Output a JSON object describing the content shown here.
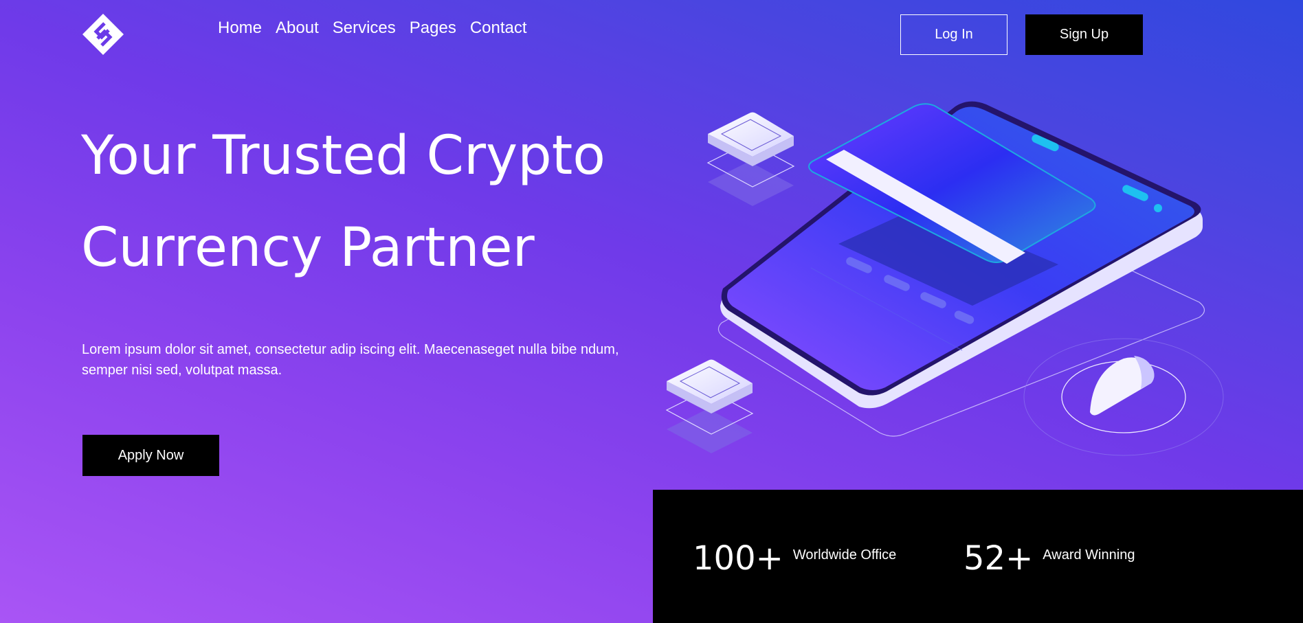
{
  "header": {
    "logo_icon": "diamond-s-logo-icon",
    "nav": [
      {
        "label": "Home"
      },
      {
        "label": "About"
      },
      {
        "label": "Services"
      },
      {
        "label": "Pages"
      },
      {
        "label": "Contact"
      }
    ],
    "login_label": "Log In",
    "signup_label": "Sign Up"
  },
  "hero": {
    "title_line1": "Your Trusted Crypto",
    "title_line2": "Currency Partner",
    "description": "Lorem ipsum dolor sit amet, consectetur adip iscing elit. Maecenaseget nulla bibe ndum, semper nisi sed, volutpat massa.",
    "apply_label": "Apply Now",
    "illustration_icon": "phone-credit-card-illustration"
  },
  "stats": [
    {
      "number": "100+",
      "label": "Worldwide Office"
    },
    {
      "number": "52+",
      "label": "Award Winning"
    }
  ],
  "colors": {
    "background_start": "#a955f5",
    "background_end": "#3048df",
    "button_dark": "#000000",
    "text": "#ffffff"
  }
}
